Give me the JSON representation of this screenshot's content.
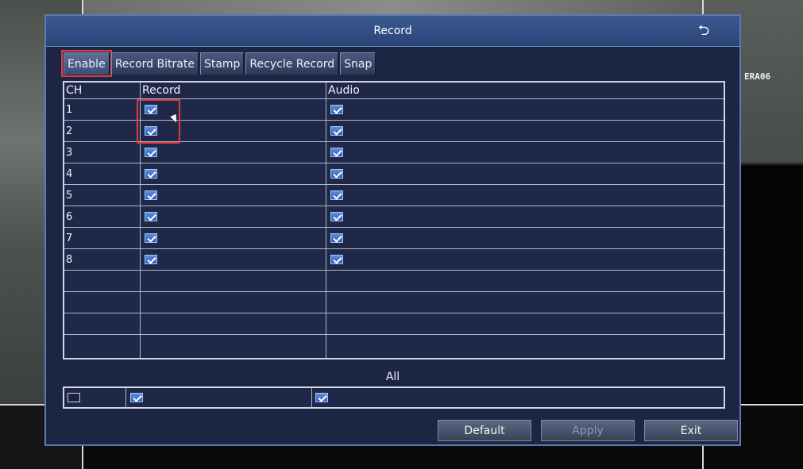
{
  "background": {
    "camera_label_right": "ERA06"
  },
  "dialog": {
    "title": "Record",
    "back_icon": "return-arrow-icon"
  },
  "tabs": [
    {
      "label": "Enable",
      "active": true
    },
    {
      "label": "Record Bitrate",
      "active": false
    },
    {
      "label": "Stamp",
      "active": false
    },
    {
      "label": "Recycle Record",
      "active": false
    },
    {
      "label": "Snap",
      "active": false
    }
  ],
  "table": {
    "headers": {
      "ch": "CH",
      "record": "Record",
      "audio": "Audio"
    },
    "rows": [
      {
        "ch": "1",
        "record": true,
        "audio": true
      },
      {
        "ch": "2",
        "record": true,
        "audio": true
      },
      {
        "ch": "3",
        "record": true,
        "audio": true
      },
      {
        "ch": "4",
        "record": true,
        "audio": true
      },
      {
        "ch": "5",
        "record": true,
        "audio": true
      },
      {
        "ch": "6",
        "record": true,
        "audio": true
      },
      {
        "ch": "7",
        "record": true,
        "audio": true
      },
      {
        "ch": "8",
        "record": true,
        "audio": true
      }
    ]
  },
  "all": {
    "label": "All",
    "ch": false,
    "record": true,
    "audio": true
  },
  "buttons": {
    "default": "Default",
    "apply": "Apply",
    "exit": "Exit"
  },
  "colors": {
    "highlight": "#e23c3c",
    "dialog_bg": "#1d2544",
    "titlebar": "#2a4478"
  }
}
